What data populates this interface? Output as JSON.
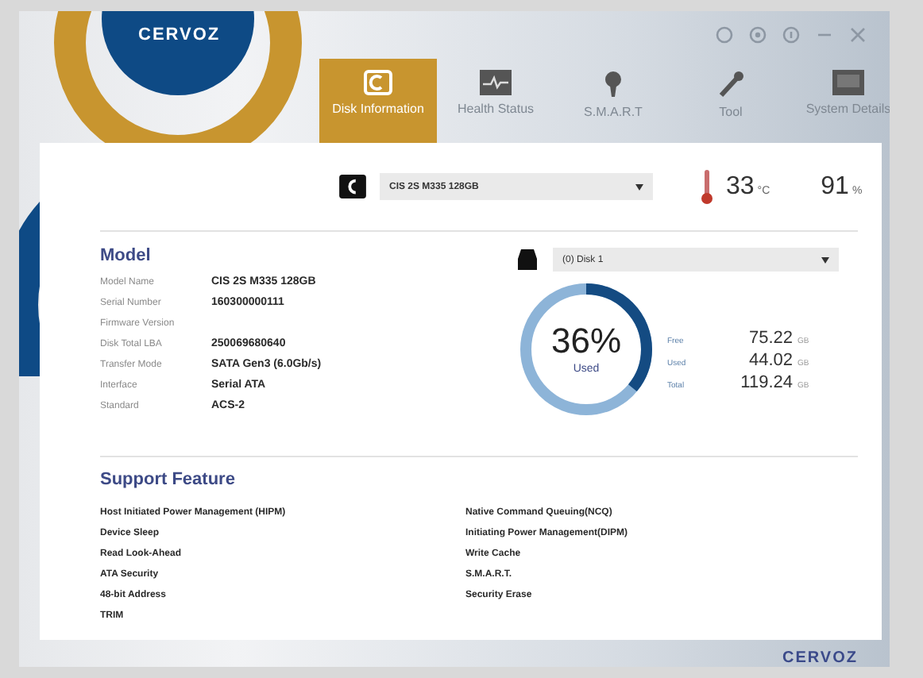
{
  "window": {
    "logo": "CERVOZ",
    "controls": [
      {
        "kind": "refresh"
      },
      {
        "kind": "settings"
      },
      {
        "kind": "info"
      },
      {
        "kind": "minimize"
      },
      {
        "kind": "close"
      }
    ]
  },
  "tabs": [
    {
      "label": "Disk Information",
      "kind": "disk",
      "selected": true
    },
    {
      "label": "Health Status",
      "kind": "pulse",
      "selected": false
    },
    {
      "label": "S.M.A.R.T",
      "kind": "bulb",
      "selected": false
    },
    {
      "label": "Tool",
      "kind": "wrench",
      "selected": false
    },
    {
      "label": "System Details",
      "kind": "screen",
      "selected": false
    }
  ],
  "device": {
    "selected_drive": "CIS 2S M335 128GB",
    "temperature": "33",
    "temperature_unit": "°C",
    "health": "91",
    "health_unit": "%"
  },
  "model": {
    "heading": "Model",
    "fields": [
      {
        "label": "Model Name",
        "value": "CIS 2S M335 128GB"
      },
      {
        "label": "Serial Number",
        "value": "160300000111"
      },
      {
        "label": "Firmware Version"
      },
      {
        "label": "Disk Total LBA",
        "value": "250069680640"
      },
      {
        "label": "Transfer Mode",
        "value": "SATA Gen3 (6.0Gb/s)"
      },
      {
        "label": "Interface",
        "value": "Serial ATA"
      },
      {
        "label": "Standard",
        "value": "ACS-2"
      }
    ]
  },
  "usage": {
    "partition": "(0) Disk 1",
    "percent": "36%",
    "caption": "Used",
    "stats": [
      {
        "label": "Free",
        "value": "75.22",
        "unit": "GB"
      },
      {
        "label": "Used",
        "value": "44.02",
        "unit": "GB"
      },
      {
        "label": "Total",
        "value": "119.24",
        "unit": "GB"
      }
    ]
  },
  "support": {
    "heading": "Support Feature",
    "columns": [
      [
        "Host Initiated Power Management (HIPM)",
        "Device Sleep",
        "Read Look-Ahead",
        "ATA Security",
        "48-bit Address",
        "TRIM"
      ],
      [
        "Native Command Queuing(NCQ)",
        "Initiating Power Management(DIPM)",
        "Write Cache",
        "S.M.A.R.T.",
        "Security Erase"
      ]
    ]
  },
  "footer": {
    "logo": "CERVOZ"
  }
}
